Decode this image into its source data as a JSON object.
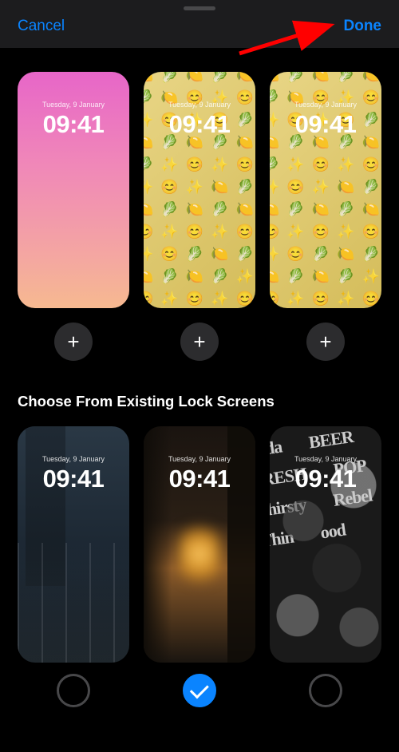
{
  "header": {
    "cancel": "Cancel",
    "done": "Done"
  },
  "suggested": {
    "items": [
      {
        "date": "Tuesday, 9 January",
        "time": "09:41",
        "bg": "pink"
      },
      {
        "date": "Tuesday, 9 January",
        "time": "09:41",
        "bg": "emoji"
      },
      {
        "date": "Tuesday, 9 January",
        "time": "09:41",
        "bg": "emoji"
      }
    ],
    "add_label": "+"
  },
  "section_title": "Choose From Existing Lock Screens",
  "existing": {
    "items": [
      {
        "date": "Tuesday, 9 January",
        "time": "09:41",
        "bg": "city1",
        "selected": false
      },
      {
        "date": "Tuesday, 9 January",
        "time": "09:41",
        "bg": "alley",
        "selected": true
      },
      {
        "date": "Tuesday, 9 January",
        "time": "09:41",
        "bg": "caps",
        "selected": false
      }
    ]
  },
  "colors": {
    "accent": "#0a84ff",
    "background": "#000000"
  },
  "annotation": {
    "arrow_target": "done-button",
    "arrow_color": "#ff0000"
  }
}
